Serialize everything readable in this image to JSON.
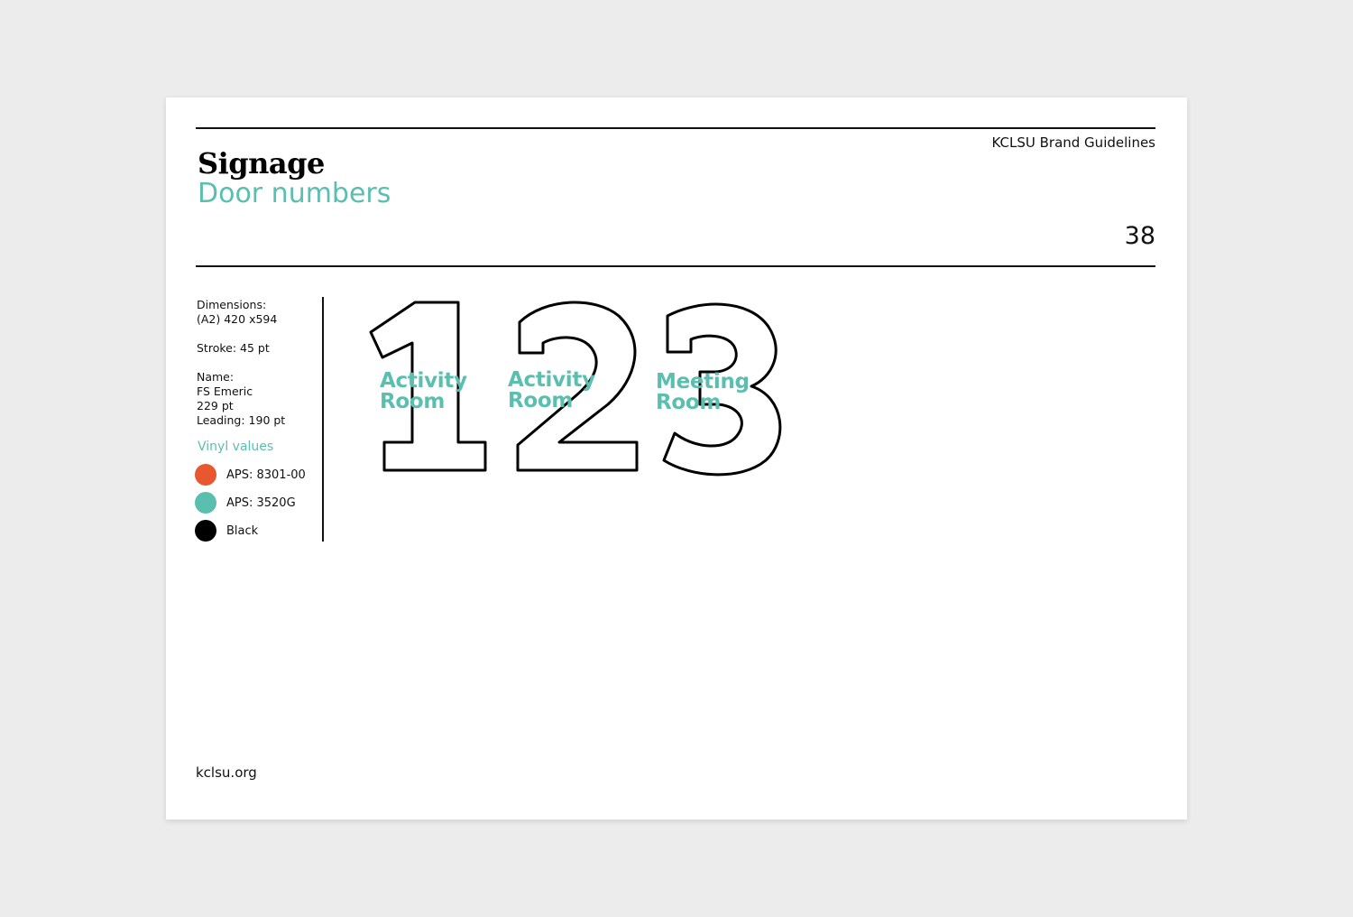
{
  "header": {
    "brand": "KCLSU Brand Guidelines",
    "title": "Signage",
    "subtitle": "Door numbers",
    "page_number": "38"
  },
  "specs": {
    "dimensions_label": "Dimensions:",
    "dimensions_value": "(A2) 420 x594",
    "stroke": "Stroke: 45 pt",
    "name_label": "Name:",
    "font_name": "FS Emeric",
    "font_size": "229 pt",
    "leading": "Leading: 190 pt"
  },
  "vinyl": {
    "heading": "Vinyl values",
    "swatches": [
      {
        "label": "APS: 8301-00",
        "color": "#e8572f"
      },
      {
        "label": "APS: 3520G",
        "color": "#5bbfb0"
      },
      {
        "label": "Black",
        "color": "#000000"
      }
    ]
  },
  "signs": [
    {
      "numeral": "1",
      "line1": "Activity",
      "line2": "Room"
    },
    {
      "numeral": "2",
      "line1": "Activity",
      "line2": "Room"
    },
    {
      "numeral": "3",
      "line1": "Meeting",
      "line2": "Room"
    }
  ],
  "colors": {
    "accent": "#5bbfb0",
    "orange": "#e8572f",
    "text": "#111111"
  },
  "footer": {
    "url": "kclsu.org"
  }
}
